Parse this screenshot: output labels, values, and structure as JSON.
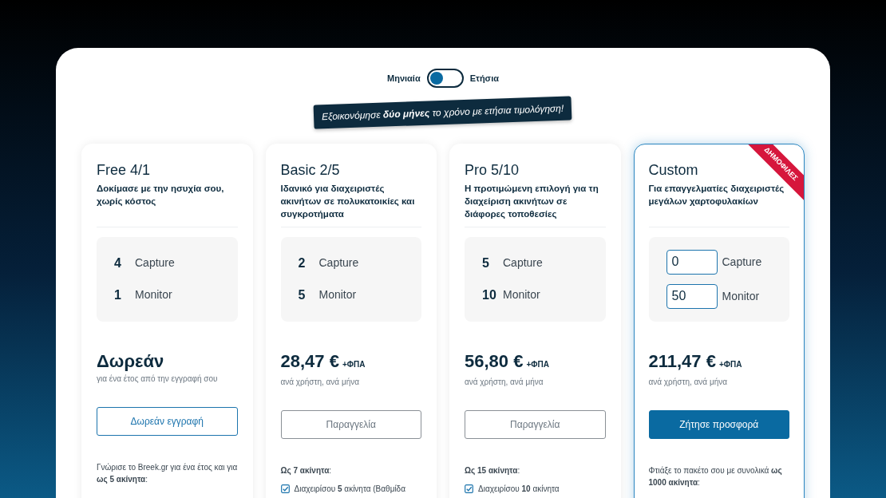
{
  "billing_toggle": {
    "off_label": "Μηνιαία",
    "on_label": "Ετήσια",
    "on": false
  },
  "promo_banner": "Εξοικονόμησε **δύο μήνες** το χρόνο με ετήσια τιμολόγηση!",
  "plans": [
    {
      "name": "Free 4/1",
      "description": "Δοκίμασε με την ησυχία σου, χωρίς κόστος",
      "quotas": [
        {
          "kind": "fixed",
          "value": "4",
          "label": "Capture"
        },
        {
          "kind": "fixed",
          "value": "1",
          "label": "Monitor"
        }
      ],
      "price": "Δωρεάν",
      "price_note": "για ένα έτος από την εγγραφή σου",
      "button": {
        "label": "Δωρεάν εγγραφή",
        "kind": "outline-blue"
      },
      "features_intro": "Γνώρισε το Breek.gr για ένα έτος και για **ως 5 ακίνητα**:"
    },
    {
      "name": "Basic 2/5",
      "description": "Ιδανικό για διαχειριστές ακινήτων σε πολυκατοικίες και συγκροτήματα",
      "quotas": [
        {
          "kind": "fixed",
          "value": "2",
          "label": "Capture"
        },
        {
          "kind": "fixed",
          "value": "5",
          "label": "Monitor"
        }
      ],
      "price": "28,47 €",
      "vat_suffix": "+ΦΠΑ",
      "price_note": "ανά χρήστη, ανά μήνα",
      "button": {
        "label": "Παραγγελία",
        "kind": "outline-grey"
      },
      "features_intro": "**Ως 7 ακίνητα**:",
      "features": [
        {
          "text": "Διαχειρίσου **5** ακίνητα (Βαθμίδα",
          "checked": true
        }
      ]
    },
    {
      "name": "Pro 5/10",
      "description": "Η προτιμώμενη επιλογή για τη διαχείριση ακινήτων σε διάφορες τοποθεσίες",
      "quotas": [
        {
          "kind": "fixed",
          "value": "5",
          "label": "Capture"
        },
        {
          "kind": "fixed",
          "value": "10",
          "label": "Monitor"
        }
      ],
      "price": "56,80 €",
      "vat_suffix": "+ΦΠΑ",
      "price_note": "ανά χρήστη, ανά μήνα",
      "button": {
        "label": "Παραγγελία",
        "kind": "outline-grey"
      },
      "features_intro": "**Ως 15 ακίνητα**:",
      "features": [
        {
          "text": "Διαχειρίσου **10** ακίνητα",
          "checked": true
        }
      ]
    },
    {
      "name": "Custom",
      "ribbon": "ΔΗΜΟΦΙΛΕΣ",
      "highlighted": true,
      "description": "Για επαγγελματίες διαχειριστές μεγάλων χαρτοφυλακίων",
      "quotas": [
        {
          "kind": "input",
          "value": "0",
          "label": "Capture"
        },
        {
          "kind": "input",
          "value": "50",
          "label": "Monitor"
        }
      ],
      "price": "211,47 €",
      "vat_suffix": "+ΦΠΑ",
      "price_note": "ανά χρήστη, ανά μήνα",
      "button": {
        "label": "Ζήτησε προσφορά",
        "kind": "solid-blue"
      },
      "features_intro": "Φτιάξε το πακέτο σου με συνολικά **ως 1000 ακίνητα**:"
    }
  ]
}
